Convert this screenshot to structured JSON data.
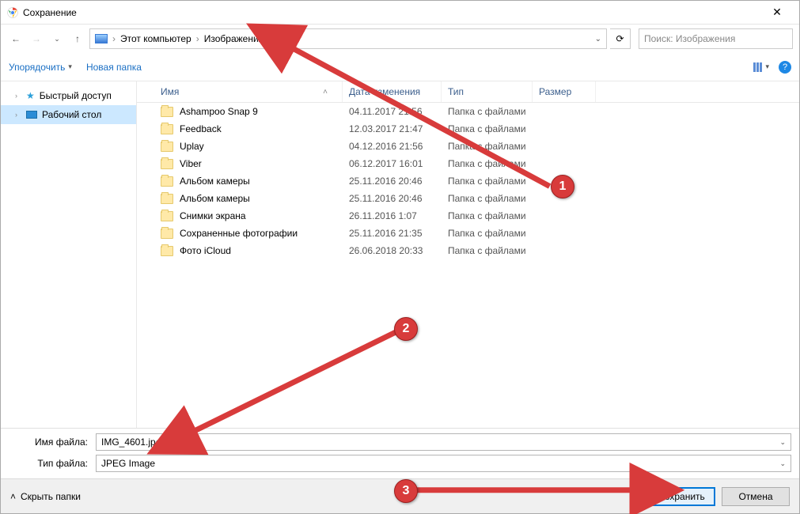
{
  "title": "Сохранение",
  "close_glyph": "✕",
  "nav": {
    "back_glyph": "←",
    "fwd_glyph": "→",
    "up_glyph": "↑",
    "dd_glyph": "⌄",
    "refresh_glyph": "⟳"
  },
  "breadcrumb": {
    "seg1": "Этот компьютер",
    "seg2": "Изображения",
    "sep": "›"
  },
  "search": {
    "placeholder": "Поиск: Изображения",
    "icon_glyph": "🔍"
  },
  "toolbar": {
    "organize": "Упорядочить",
    "newfolder": "Новая папка",
    "dd_glyph": "▾"
  },
  "sidebar": {
    "items": [
      {
        "label": "Быстрый доступ",
        "icon": "star"
      },
      {
        "label": "Рабочий стол",
        "icon": "desktop",
        "selected": true
      }
    ],
    "chev": "›"
  },
  "columns": {
    "name": "Имя",
    "date": "Дата изменения",
    "type": "Тип",
    "size": "Размер",
    "sort_glyph": "˄"
  },
  "type_folder": "Папка с файлами",
  "files": [
    {
      "name": "Ashampoo Snap 9",
      "date": "04.11.2017 21:56"
    },
    {
      "name": "Feedback",
      "date": "12.03.2017 21:47"
    },
    {
      "name": "Uplay",
      "date": "04.12.2016 21:56"
    },
    {
      "name": "Viber",
      "date": "06.12.2017 16:01"
    },
    {
      "name": "Альбом камеры",
      "date": "25.11.2016 20:46"
    },
    {
      "name": "Альбом камеры",
      "date": "25.11.2016 20:46"
    },
    {
      "name": "Снимки экрана",
      "date": "26.11.2016 1:07"
    },
    {
      "name": "Сохраненные фотографии",
      "date": "25.11.2016 21:35"
    },
    {
      "name": "Фото iCloud",
      "date": "26.06.2018 20:33"
    }
  ],
  "footer": {
    "filename_label": "Имя файла:",
    "filetype_label": "Тип файла:",
    "filename_value": "IMG_4601.jpeg",
    "filetype_value": "JPEG Image"
  },
  "actions": {
    "hide_folders": "Скрыть папки",
    "hide_glyph": "˄",
    "save": "Сохранить",
    "cancel": "Отмена"
  },
  "annotations": {
    "m1": "1",
    "m2": "2",
    "m3": "3"
  }
}
